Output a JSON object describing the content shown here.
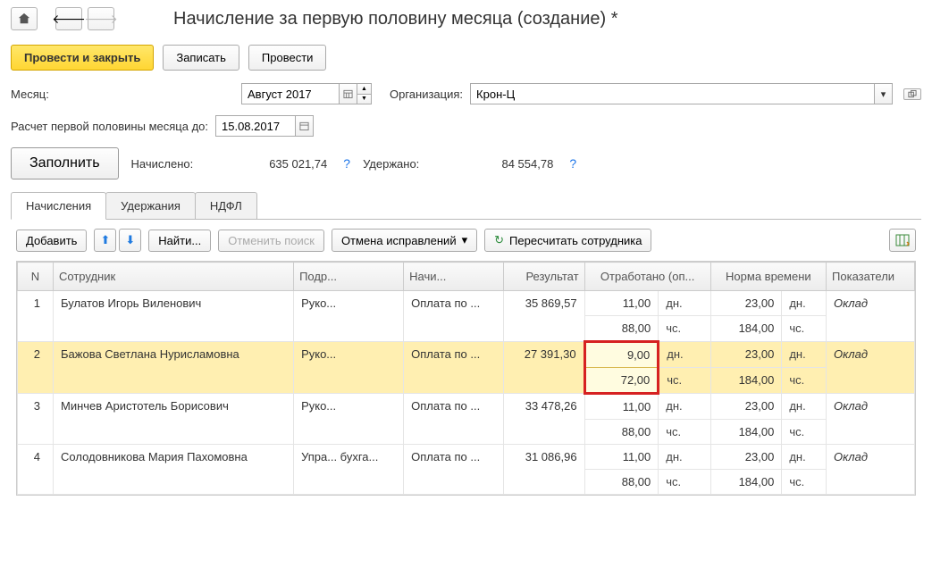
{
  "page": {
    "title": "Начисление за первую половину месяца (создание) *"
  },
  "actions": {
    "post_and_close": "Провести и закрыть",
    "save": "Записать",
    "post": "Провести"
  },
  "form": {
    "month_label": "Месяц:",
    "month_value": "Август 2017",
    "org_label": "Организация:",
    "org_value": "Крон-Ц",
    "calc_to_label": "Расчет первой половины месяца до:",
    "calc_to_value": "15.08.2017",
    "fill_btn": "Заполнить",
    "accrued_label": "Начислено:",
    "accrued_value": "635 021,74",
    "withheld_label": "Удержано:",
    "withheld_value": "84 554,78"
  },
  "tabs": {
    "t1": "Начисления",
    "t2": "Удержания",
    "t3": "НДФЛ"
  },
  "toolbar": {
    "add": "Добавить",
    "find": "Найти...",
    "cancel_search": "Отменить поиск",
    "cancel_corrections": "Отмена исправлений",
    "recalculate": "Пересчитать сотрудника"
  },
  "table": {
    "headers": {
      "n": "N",
      "employee": "Сотрудник",
      "dept": "Подр...",
      "calc": "Начи...",
      "result": "Результат",
      "worked": "Отработано (оп...",
      "norm": "Норма времени",
      "indicators": "Показатели"
    },
    "rows": [
      {
        "n": "1",
        "employee": "Булатов Игорь Виленович",
        "dept": "Руко...",
        "calc": "Оплата по ...",
        "result": "35 869,57",
        "worked_days": "11,00",
        "worked_hours": "88,00",
        "norm_days": "23,00",
        "norm_hours": "184,00",
        "indicator": "Оклад",
        "highlighted": false
      },
      {
        "n": "2",
        "employee": "Бажова Светлана Нурисламовна",
        "dept": "Руко...",
        "calc": "Оплата по ...",
        "result": "27 391,30",
        "worked_days": "9,00",
        "worked_hours": "72,00",
        "norm_days": "23,00",
        "norm_hours": "184,00",
        "indicator": "Оклад",
        "highlighted": true
      },
      {
        "n": "3",
        "employee": "Минчев Аристотель Борисович",
        "dept": "Руко...",
        "calc": "Оплата по ...",
        "result": "33 478,26",
        "worked_days": "11,00",
        "worked_hours": "88,00",
        "norm_days": "23,00",
        "norm_hours": "184,00",
        "indicator": "Оклад",
        "highlighted": false
      },
      {
        "n": "4",
        "employee": "Солодовникова Мария Пахомовна",
        "dept": "Упра... бухга...",
        "calc": "Оплата по ...",
        "result": "31 086,96",
        "worked_days": "11,00",
        "worked_hours": "88,00",
        "norm_days": "23,00",
        "norm_hours": "184,00",
        "indicator": "Оклад",
        "highlighted": false
      }
    ],
    "units": {
      "dn": "дн.",
      "ch": "чс."
    }
  }
}
